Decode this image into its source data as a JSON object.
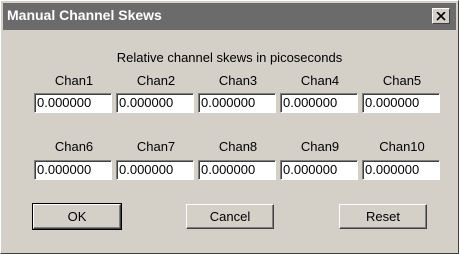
{
  "window": {
    "title": "Manual Channel Skews",
    "close_glyph": "✕"
  },
  "header": "Relative channel skews in picoseconds",
  "channels": [
    {
      "label": "Chan1",
      "value": "0.000000"
    },
    {
      "label": "Chan2",
      "value": "0.000000"
    },
    {
      "label": "Chan3",
      "value": "0.000000"
    },
    {
      "label": "Chan4",
      "value": "0.000000"
    },
    {
      "label": "Chan5",
      "value": "0.000000"
    },
    {
      "label": "Chan6",
      "value": "0.000000"
    },
    {
      "label": "Chan7",
      "value": "0.000000"
    },
    {
      "label": "Chan8",
      "value": "0.000000"
    },
    {
      "label": "Chan9",
      "value": "0.000000"
    },
    {
      "label": "Chan10",
      "value": "0.000000"
    }
  ],
  "buttons": {
    "ok": "OK",
    "cancel": "Cancel",
    "reset": "Reset"
  }
}
